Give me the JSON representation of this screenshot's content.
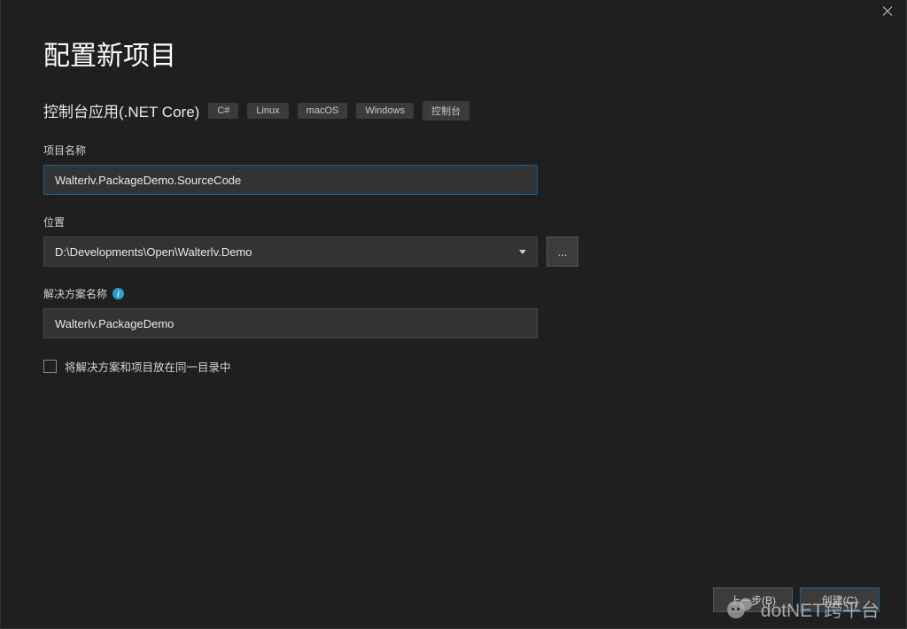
{
  "header": {
    "title": "配置新项目",
    "subtitle": "控制台应用(.NET Core)",
    "tags": [
      "C#",
      "Linux",
      "macOS",
      "Windows",
      "控制台"
    ]
  },
  "fields": {
    "projectName": {
      "label": "项目名称",
      "value": "Walterlv.PackageDemo.SourceCode"
    },
    "location": {
      "label": "位置",
      "value": "D:\\Developments\\Open\\Walterlv.Demo",
      "browse": "..."
    },
    "solutionName": {
      "label": "解决方案名称",
      "value": "Walterlv.PackageDemo"
    },
    "sameDir": {
      "label": "将解决方案和项目放在同一目录中"
    }
  },
  "footer": {
    "back": "上一步(B)",
    "create": "创建(C)"
  },
  "watermark": "dotNET跨平台"
}
